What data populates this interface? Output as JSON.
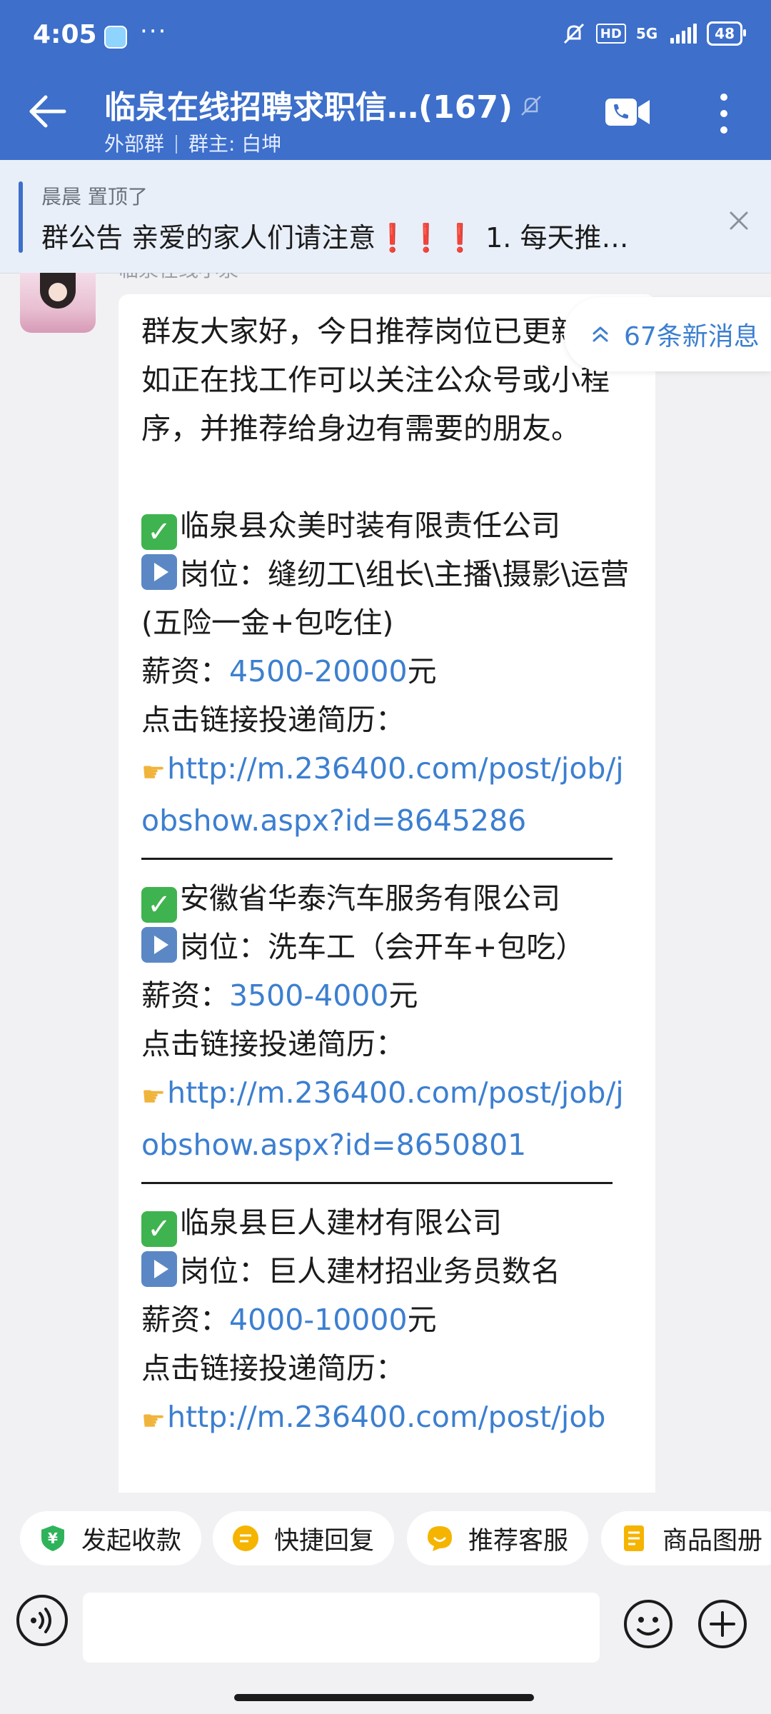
{
  "status_bar": {
    "time": "4:05",
    "dots": "···",
    "hd": "HD",
    "network": "5G",
    "battery": "48"
  },
  "header": {
    "title": "临泉在线招聘求职信…(167)",
    "group_type": "外部群",
    "owner": "群主: 白坤",
    "accent_color": "#3d6fcb"
  },
  "announcement": {
    "who": "晨晨  置顶了",
    "text": "群公告  亲爱的家人们请注意❗❗❗ 1. 每天推…"
  },
  "message": {
    "sender": "临泉在线小泉",
    "intro": "群友大家好，今日推荐岗位已更新；如正在找工作可以关注公众号或小程序，并推荐给身边有需要的朋友。",
    "jobs": [
      {
        "company": "临泉县众美时装有限责任公司",
        "position": "岗位：缝纫工\\组长\\主播\\摄影\\运营(五险一金+包吃住)",
        "salary_label": "薪资：",
        "salary": "4500-20000",
        "salary_unit": "元",
        "apply": "点击链接投递简历：",
        "link": "http://m.236400.com/post/job/jobshow.aspx?id=8645286"
      },
      {
        "company": "安徽省华泰汽车服务有限公司",
        "position": "岗位：洗车工（会开车+包吃）",
        "salary_label": "薪资：",
        "salary": "3500-4000",
        "salary_unit": "元",
        "apply": "点击链接投递简历：",
        "link": "http://m.236400.com/post/job/jobshow.aspx?id=8650801"
      },
      {
        "company": "临泉县巨人建材有限公司",
        "position": "岗位：巨人建材招业务员数名",
        "salary_label": "薪资：",
        "salary": "4000-10000",
        "salary_unit": "元",
        "apply": "点击链接投递简历：",
        "link": "http://m.236400.com/post/job"
      }
    ]
  },
  "new_messages": {
    "label": "67条新消息"
  },
  "quick_actions": [
    {
      "label": "发起收款",
      "icon": "yuan-shield-icon",
      "color": "#2fb35a"
    },
    {
      "label": "快捷回复",
      "icon": "quick-reply-icon",
      "color": "#f5b400"
    },
    {
      "label": "推荐客服",
      "icon": "service-icon",
      "color": "#f5b400"
    },
    {
      "label": "商品图册",
      "icon": "catalog-icon",
      "color": "#f5b400"
    }
  ]
}
